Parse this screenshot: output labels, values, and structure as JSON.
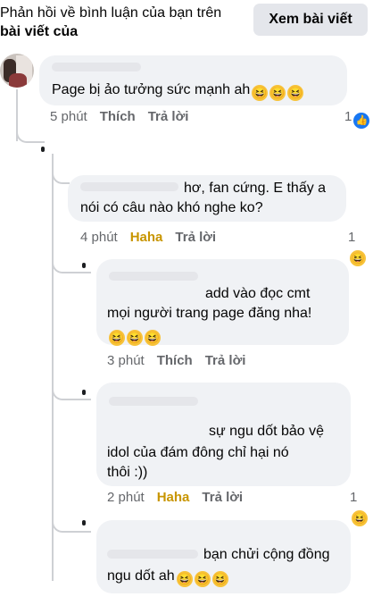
{
  "header": {
    "text_line1": "Phản hồi về bình luận của bạn trên",
    "text_line2_bold": "bài viết của",
    "view_post_button": "Xem bài viết"
  },
  "comments": [
    {
      "text": "Page bị ảo tưởng sức mạnh ah",
      "emoji_icon": "laughing-emoji-icon",
      "time": "5 phút",
      "action_label": "Thích",
      "reply_label": "Trả lời",
      "reaction_count": "1",
      "reaction_icon": "like-icon"
    },
    {
      "text_line1": "hơ, fan cứng. E thấy a",
      "text_line2": "nói có câu nào khó nghe ko?",
      "time": "4 phút",
      "action_label": "Haha",
      "reply_label": "Trả lời",
      "reaction_count": "1",
      "reaction_icon": "haha-icon"
    },
    {
      "text_line1": "add vào đọc cmt",
      "text_line2": "mọi người trang page đăng nha!",
      "emoji_icon": "laughing-emoji-icon",
      "time": "3 phút",
      "action_label": "Thích",
      "reply_label": "Trả lời"
    },
    {
      "text_line1": "sự ngu dốt bảo vệ",
      "text_line2": "idol của đám đông chỉ hại nó",
      "text_line3": "thôi :))",
      "time": "2 phút",
      "action_label": "Haha",
      "reply_label": "Trả lời",
      "reaction_count": "1",
      "reaction_icon": "haha-icon"
    },
    {
      "text_line1": "bạn chửi cộng đồng",
      "text_line2": "ngu dốt ah",
      "emoji_icon": "laughing-emoji-icon"
    }
  ],
  "colors": {
    "bubble": "#f0f2f5",
    "meta_text": "#65676b",
    "like_blue": "#1877f2",
    "haha_yellow": "#f7c33a"
  }
}
